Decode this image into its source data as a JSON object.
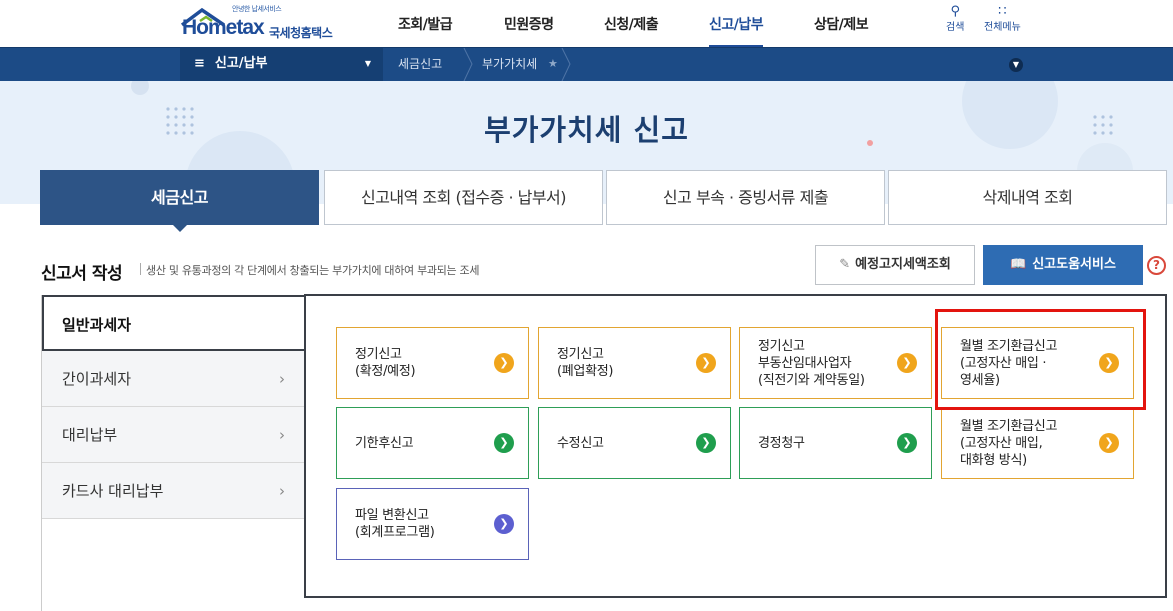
{
  "header": {
    "logo_small": "안녕한 납세서비스",
    "logo_main": "Hometax",
    "logo_korean": "국세청홈택스",
    "nav": [
      "조회/발급",
      "민원증명",
      "신청/제출",
      "신고/납부",
      "상담/제보"
    ],
    "search_label": "검색",
    "allmenu_label": "전체메뉴"
  },
  "subnav": {
    "menu_label": "신고/납부",
    "crumbs": [
      "세금신고",
      "부가가치세"
    ]
  },
  "hero": {
    "title": "부가가치세 신고"
  },
  "tabs": [
    "세금신고",
    "신고내역 조회 (접수증 · 납부서)",
    "신고 부속 · 증빙서류 제출",
    "삭제내역 조회"
  ],
  "section": {
    "title": "신고서 작성",
    "desc": "생산 및 유통과정의 각 단계에서 창출되는 부가가치에 대하여 부과되는 조세",
    "btn_estimate": "예정고지세액조회",
    "btn_help": "신고도움서비스",
    "help_q": "?"
  },
  "side": [
    "일반과세자",
    "간이과세자",
    "대리납부",
    "카드사 대리납부"
  ],
  "cards": [
    "정기신고\n(확정/예정)",
    "정기신고\n(폐업확정)",
    "정기신고\n부동산임대사업자\n(직전기와 계약동일)",
    "월별 조기환급신고\n(고정자산 매입 ·\n영세율)",
    "기한후신고",
    "수정신고",
    "경정청구",
    "월별 조기환급신고\n(고정자산 매입,\n대화형 방식)",
    "파일 변환신고\n(회계프로그램)"
  ],
  "icons": {
    "arrow": "chevron-right-icon"
  },
  "colors": {
    "brand": "#1f4d99",
    "orange": "#f0a51c",
    "green": "#1f9e4d",
    "purple": "#5c5fd0",
    "highlight": "#e3140e"
  }
}
